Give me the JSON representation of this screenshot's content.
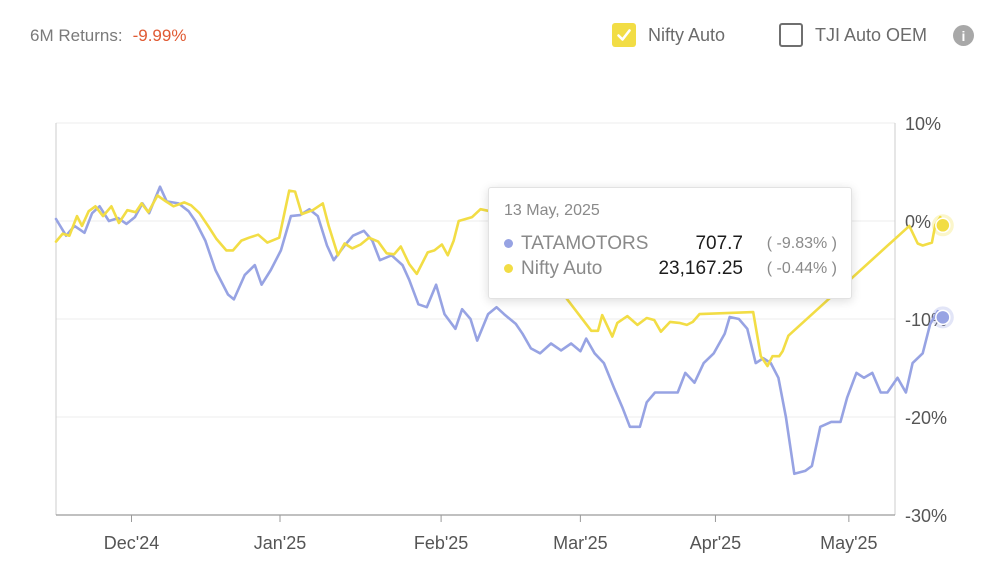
{
  "header": {
    "returns_label": "6M Returns:",
    "returns_value": "-9.99%",
    "returns_color": "#e05a33"
  },
  "legend": [
    {
      "label": "Nifty Auto",
      "checked": true,
      "color": "#f2dd45"
    },
    {
      "label": "TJI Auto OEM",
      "checked": false
    }
  ],
  "info_icon": "info-icon",
  "tooltip": {
    "date": "13 May, 2025",
    "rows": [
      {
        "name": "TATAMOTORS",
        "value": "707.7",
        "pct": "( -9.83% )",
        "color": "#97a3e3"
      },
      {
        "name": "Nifty Auto",
        "value": "23,167.25",
        "pct": "( -0.44% )",
        "color": "#f2dd45"
      }
    ]
  },
  "chart_data": {
    "type": "line",
    "title": "",
    "xlabel": "",
    "ylabel": "",
    "x_range": [
      0,
      100
    ],
    "ylim": [
      -30,
      10
    ],
    "y_ticks": [
      10,
      0,
      -10,
      -20,
      -30
    ],
    "y_tick_labels": [
      "10%",
      "0%",
      "-10%",
      "-20%",
      "-30%"
    ],
    "x_ticks": [
      {
        "pos": 9,
        "label": "Dec'24"
      },
      {
        "pos": 26.7,
        "label": "Jan'25"
      },
      {
        "pos": 45.9,
        "label": "Feb'25"
      },
      {
        "pos": 62.5,
        "label": "Mar'25"
      },
      {
        "pos": 78.6,
        "label": "Apr'25"
      },
      {
        "pos": 94.5,
        "label": "May'25"
      }
    ],
    "grid": true,
    "series": [
      {
        "name": "TATAMOTORS",
        "color": "#97a3e3",
        "points": [
          [
            0,
            0.2
          ],
          [
            1.2,
            -1.5
          ],
          [
            2.2,
            -0.5
          ],
          [
            3.4,
            -1.2
          ],
          [
            4.3,
            0.8
          ],
          [
            5.2,
            1.5
          ],
          [
            6.3,
            0
          ],
          [
            7.4,
            0.3
          ],
          [
            8.4,
            -0.3
          ],
          [
            9.4,
            0.4
          ],
          [
            10.3,
            1.8
          ],
          [
            11.1,
            0.8
          ],
          [
            12.4,
            3.5
          ],
          [
            13.2,
            2
          ],
          [
            14.6,
            1.8
          ],
          [
            15.8,
            1
          ],
          [
            16.6,
            0
          ],
          [
            17.8,
            -2
          ],
          [
            19,
            -5
          ],
          [
            20.5,
            -7.5
          ],
          [
            21.2,
            -8
          ],
          [
            22.5,
            -5.5
          ],
          [
            23.7,
            -4.5
          ],
          [
            24.5,
            -6.5
          ],
          [
            25.6,
            -5
          ],
          [
            26.8,
            -3
          ],
          [
            28,
            0.5
          ],
          [
            29.1,
            0.6
          ],
          [
            30.2,
            1.2
          ],
          [
            31.2,
            0.5
          ],
          [
            32.3,
            -2.5
          ],
          [
            33.1,
            -4
          ],
          [
            34.4,
            -2.5
          ],
          [
            35.4,
            -1.5
          ],
          [
            36.7,
            -1
          ],
          [
            37.7,
            -2
          ],
          [
            38.6,
            -4
          ],
          [
            40,
            -3.5
          ],
          [
            41.3,
            -4.5
          ],
          [
            42.1,
            -6
          ],
          [
            43.2,
            -8.5
          ],
          [
            44.2,
            -8.8
          ],
          [
            45.3,
            -6.5
          ],
          [
            46.3,
            -9.5
          ],
          [
            47.6,
            -11
          ],
          [
            48.4,
            -9
          ],
          [
            49.4,
            -10
          ],
          [
            50.2,
            -12.2
          ],
          [
            51.5,
            -9.5
          ],
          [
            52.5,
            -8.8
          ],
          [
            53.4,
            -9.5
          ],
          [
            54.8,
            -10.5
          ],
          [
            55.6,
            -11.5
          ],
          [
            56.6,
            -13
          ],
          [
            57.7,
            -13.5
          ],
          [
            59,
            -12.5
          ],
          [
            60.2,
            -13.2
          ],
          [
            61.4,
            -12.5
          ],
          [
            62.5,
            -13.3
          ],
          [
            63.2,
            -12
          ],
          [
            64.2,
            -13.5
          ],
          [
            65.3,
            -14.5
          ],
          [
            66.5,
            -17
          ],
          [
            67.5,
            -19
          ],
          [
            68.4,
            -21
          ],
          [
            69.6,
            -21
          ],
          [
            70.4,
            -18.5
          ],
          [
            71.4,
            -17.5
          ],
          [
            72.4,
            -17.5
          ],
          [
            73.2,
            -17.5
          ],
          [
            74.1,
            -17.5
          ],
          [
            75,
            -15.5
          ],
          [
            76.1,
            -16.5
          ],
          [
            77.2,
            -14.5
          ],
          [
            78.4,
            -13.5
          ],
          [
            79.7,
            -11.5
          ],
          [
            80.3,
            -9.8
          ],
          [
            81.4,
            -10
          ],
          [
            82.4,
            -11
          ],
          [
            83.4,
            -14.5
          ],
          [
            84.3,
            -14
          ],
          [
            85.2,
            -14.5
          ],
          [
            86.1,
            -16
          ],
          [
            87,
            -20
          ],
          [
            88,
            -25.8
          ],
          [
            89.3,
            -25.5
          ],
          [
            90.1,
            -25
          ],
          [
            91.1,
            -21
          ],
          [
            92.4,
            -20.5
          ],
          [
            93.5,
            -20.5
          ],
          [
            94.3,
            -18
          ],
          [
            95.4,
            -15.5
          ],
          [
            96.3,
            -16
          ],
          [
            97.3,
            -15.5
          ],
          [
            98.3,
            -17.5
          ],
          [
            99.1,
            -17.5
          ],
          [
            100.3,
            -16
          ],
          [
            101.3,
            -17.5
          ],
          [
            102.1,
            -14.5
          ],
          [
            103.3,
            -13.5
          ],
          [
            104.2,
            -10.5
          ],
          [
            105.1,
            -9.2
          ],
          [
            105.7,
            -9.8
          ]
        ]
      },
      {
        "name": "Nifty Auto",
        "color": "#f2dd45",
        "points": [
          [
            0,
            -2.1
          ],
          [
            0.8,
            -1.3
          ],
          [
            1.6,
            -1.5
          ],
          [
            2.5,
            0.5
          ],
          [
            3.1,
            -0.5
          ],
          [
            3.9,
            1
          ],
          [
            4.7,
            1.5
          ],
          [
            5.6,
            0.5
          ],
          [
            6.6,
            1.5
          ],
          [
            7.5,
            -0.2
          ],
          [
            8.5,
            1.1
          ],
          [
            9.5,
            0.9
          ],
          [
            10.2,
            1.8
          ],
          [
            11,
            0.9
          ],
          [
            12.1,
            2.6
          ],
          [
            13.1,
            2
          ],
          [
            14,
            1.5
          ],
          [
            15.3,
            1.9
          ],
          [
            16.1,
            1.6
          ],
          [
            17.1,
            0.8
          ],
          [
            18.2,
            -0.6
          ],
          [
            19.1,
            -1.8
          ],
          [
            20.3,
            -3
          ],
          [
            21.1,
            -3
          ],
          [
            22.1,
            -2
          ],
          [
            23,
            -1.7
          ],
          [
            24.1,
            -1.4
          ],
          [
            25.2,
            -2.2
          ],
          [
            26.6,
            -1.7
          ],
          [
            27.8,
            3.1
          ],
          [
            28.5,
            3
          ],
          [
            29.3,
            0.7
          ],
          [
            30.6,
            1.1
          ],
          [
            31.8,
            1.8
          ],
          [
            32.5,
            -0.5
          ],
          [
            33.6,
            -3.5
          ],
          [
            34.4,
            -2.3
          ],
          [
            35.3,
            -2.8
          ],
          [
            36.3,
            -2.4
          ],
          [
            37.3,
            -1.7
          ],
          [
            38.4,
            -2.1
          ],
          [
            39.4,
            -3.3
          ],
          [
            40.3,
            -3.4
          ],
          [
            41.1,
            -2.6
          ],
          [
            42.1,
            -4.4
          ],
          [
            43,
            -5.4
          ],
          [
            44.3,
            -3.2
          ],
          [
            45.1,
            -3
          ],
          [
            46,
            -2.4
          ],
          [
            46.7,
            -3.5
          ],
          [
            47.4,
            -2
          ],
          [
            48,
            0
          ],
          [
            49.6,
            0.4
          ],
          [
            50.6,
            1.2
          ],
          [
            51.7,
            1
          ],
          [
            52.8,
            0.8
          ],
          [
            53.6,
            0.2
          ],
          [
            63.8,
            -11.2
          ],
          [
            64.6,
            -11.2
          ],
          [
            65.1,
            -9.6
          ],
          [
            66.3,
            -11.8
          ],
          [
            66.9,
            -10.4
          ],
          [
            68.1,
            -9.7
          ],
          [
            69.3,
            -10.6
          ],
          [
            70.4,
            -9.9
          ],
          [
            71.3,
            -10.1
          ],
          [
            72.1,
            -11.3
          ],
          [
            73.2,
            -10.3
          ],
          [
            74.3,
            -10.4
          ],
          [
            75.2,
            -10.6
          ],
          [
            75.9,
            -10.3
          ],
          [
            76.7,
            -9.5
          ],
          [
            83.1,
            -9.3
          ],
          [
            84,
            -13.8
          ],
          [
            84.8,
            -14.8
          ],
          [
            85.4,
            -13.8
          ],
          [
            86.2,
            -13.8
          ],
          [
            86.6,
            -13.3
          ],
          [
            87.3,
            -11.7
          ],
          [
            101.7,
            -0.5
          ],
          [
            102.7,
            -2.3
          ],
          [
            103.3,
            -2.5
          ],
          [
            104.4,
            -2.2
          ],
          [
            104.8,
            -0.4
          ],
          [
            105.4,
            0.4
          ],
          [
            105.7,
            -0.4
          ]
        ]
      }
    ],
    "markers": [
      {
        "series": "TATAMOTORS",
        "x": 105.7,
        "y": -9.83
      },
      {
        "series": "Nifty Auto",
        "x": 105.7,
        "y": -0.44
      }
    ]
  }
}
